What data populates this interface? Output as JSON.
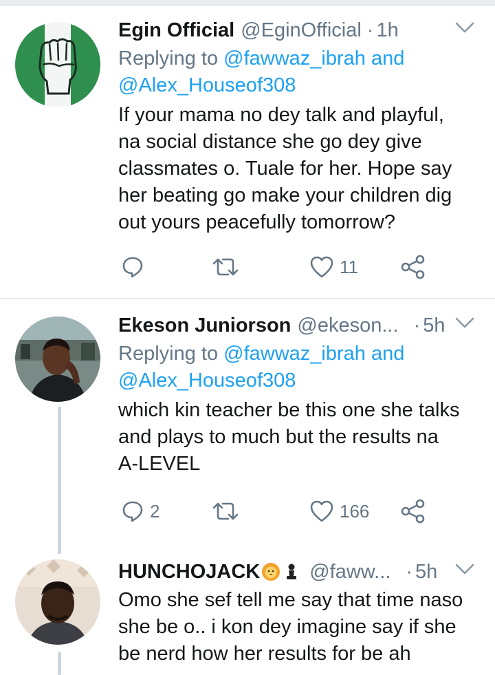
{
  "tweets": [
    {
      "name": "Egin Official",
      "handle": "@EginOfficial",
      "dot": "·",
      "time": "1h",
      "replying_prefix": "Replying to",
      "replying_user1": "@fawwaz_ibrah",
      "replying_and": "and",
      "replying_user2": "@Alex_Houseof308",
      "lines": [
        "If your mama no dey talk and playful,",
        "na social distance she go dey give",
        "classmates o. Tuale for her. Hope say",
        "her beating go make your children dig",
        "out yours peacefully tomorrow?"
      ],
      "reply_count": "",
      "retweet_count": "",
      "like_count": "11"
    },
    {
      "name": "Ekeson Juniorson",
      "handle": "@ekeson...",
      "dot": "·",
      "time": "5h",
      "replying_prefix": "Replying to",
      "replying_user1": "@fawwaz_ibrah",
      "replying_and": "and",
      "replying_user2": "@Alex_Houseof308",
      "lines": [
        "which kin teacher be this one she talks",
        "and plays to much but the results na",
        "A-LEVEL"
      ],
      "reply_count": "2",
      "retweet_count": "",
      "like_count": "166"
    },
    {
      "name": "HUNCHOJACK",
      "name_emojis": [
        "lion-face-icon",
        "chess-pawn-icon"
      ],
      "handle": "@faww...",
      "dot": "·",
      "time": "5h",
      "lines": [
        "Omo she sef tell me say that time naso",
        "she be o.. i kon dey imagine say if she",
        "be nerd how her results for be ah"
      ]
    }
  ],
  "colors": {
    "text": "#14171a",
    "secondary": "#657786",
    "link": "#1da1f2",
    "divider": "#e6ecf0",
    "thread_line": "#ccd6dd"
  },
  "icons": [
    "reply-icon",
    "retweet-icon",
    "like-icon",
    "share-icon",
    "chevron-down-icon"
  ]
}
